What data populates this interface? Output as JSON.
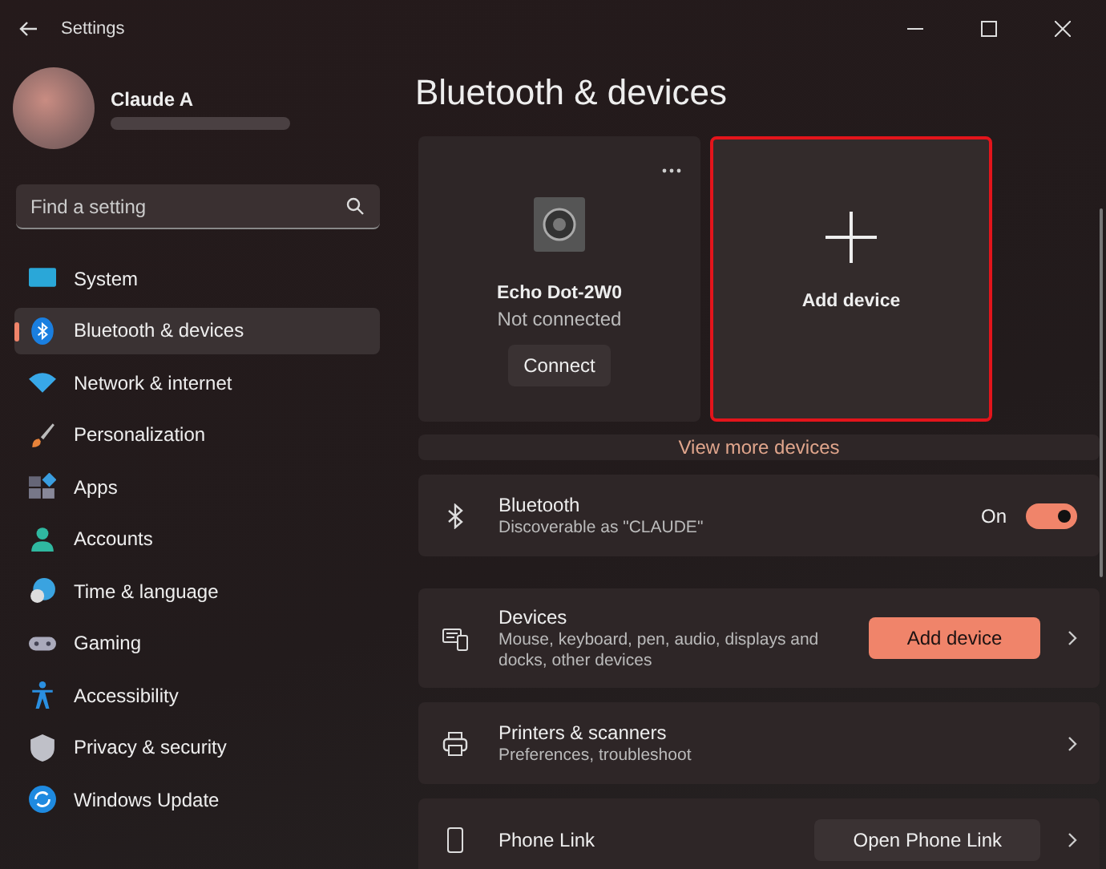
{
  "window": {
    "title": "Settings"
  },
  "profile": {
    "name": "Claude A"
  },
  "search": {
    "placeholder": "Find a setting"
  },
  "sidebar": {
    "items": [
      {
        "label": "System",
        "selected": false
      },
      {
        "label": "Bluetooth & devices",
        "selected": true
      },
      {
        "label": "Network & internet",
        "selected": false
      },
      {
        "label": "Personalization",
        "selected": false
      },
      {
        "label": "Apps",
        "selected": false
      },
      {
        "label": "Accounts",
        "selected": false
      },
      {
        "label": "Time & language",
        "selected": false
      },
      {
        "label": "Gaming",
        "selected": false
      },
      {
        "label": "Accessibility",
        "selected": false
      },
      {
        "label": "Privacy & security",
        "selected": false
      },
      {
        "label": "Windows Update",
        "selected": false
      }
    ]
  },
  "page_title": "Bluetooth & devices",
  "device_card": {
    "name": "Echo Dot-2W0",
    "status": "Not connected",
    "button": "Connect"
  },
  "add_card": {
    "label": "Add device",
    "highlighted": true
  },
  "view_more": "View more devices",
  "settings": [
    {
      "kind": "toggle",
      "title": "Bluetooth",
      "description": "Discoverable as \"CLAUDE\"",
      "state_label": "On",
      "on": true
    },
    {
      "kind": "button",
      "title": "Devices",
      "description": "Mouse, keyboard, pen, audio, displays and docks, other devices",
      "button": "Add device",
      "primary": true
    },
    {
      "kind": "link",
      "title": "Printers & scanners",
      "description": "Preferences, troubleshoot"
    },
    {
      "kind": "button",
      "title": "Phone Link",
      "button": "Open Phone Link",
      "primary": false
    }
  ]
}
